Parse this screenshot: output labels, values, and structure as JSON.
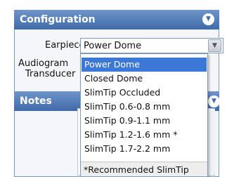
{
  "config": {
    "title": "Configuration",
    "earpiece_label": "Earpiece",
    "audiogram_label": "Audiogram",
    "transducer_label": "Transducer",
    "earpiece_value": "Power Dome"
  },
  "notes": {
    "title": "Notes"
  },
  "dropdown": {
    "options": [
      "Power Dome",
      "Closed Dome",
      "SlimTip Occluded",
      "SlimTip 0.6-0.8 mm",
      "SlimTip 0.9-1.1 mm",
      "SlimTip 1.2-1.6 mm *",
      "SlimTip 1.7-2.2 mm"
    ],
    "selected_index": 0,
    "footnote": "*Recommended SlimTip"
  },
  "icons": {
    "collapse": "chevron-down-icon",
    "dropdown": "dropdown-arrow-icon"
  }
}
